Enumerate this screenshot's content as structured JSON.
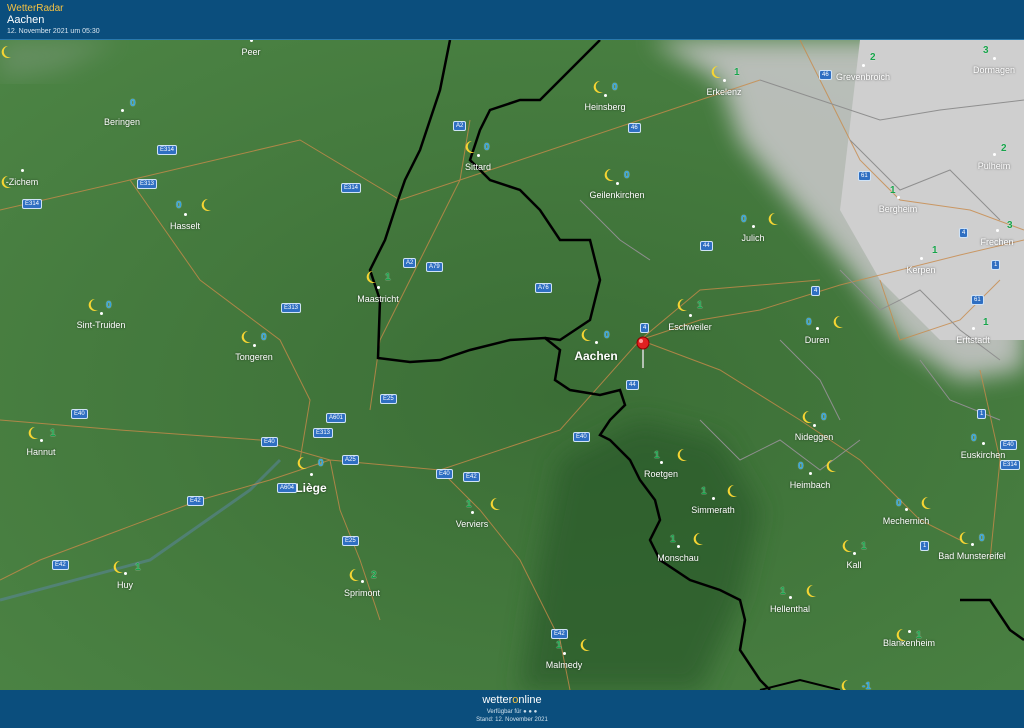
{
  "header": {
    "brand": "WetterRadar",
    "location": "Aachen",
    "timestamp": "12. November 2021 um 05:30"
  },
  "footer": {
    "logo_part1": "wetter",
    "logo_o": "o",
    "logo_part2": "nline",
    "available": "Verfügbar für ● ● ●",
    "stand": "Stand: 12. November 2021"
  },
  "colors": {
    "land": "#3d7437",
    "cloud": "#c9c9c9",
    "header": "#0b4e7d",
    "temp_below": "#2fa3e0",
    "temp_above": "#17a34a",
    "moon": "#f6d533"
  },
  "places": [
    {
      "id": "peer",
      "name": "Peer",
      "temp": ""
    },
    {
      "id": "beringen",
      "name": "Beringen",
      "temp": "0"
    },
    {
      "id": "zichem",
      "name": "-Zichem",
      "temp": ""
    },
    {
      "id": "hasselt",
      "name": "Hasselt",
      "temp": "0"
    },
    {
      "id": "sint-truiden",
      "name": "Sint-Truiden",
      "temp": "0"
    },
    {
      "id": "tongeren",
      "name": "Tongeren",
      "temp": "0"
    },
    {
      "id": "hannut",
      "name": "Hannut",
      "temp": "1"
    },
    {
      "id": "liege",
      "name": "Liège",
      "temp": "0"
    },
    {
      "id": "huy",
      "name": "Huy",
      "temp": "1"
    },
    {
      "id": "sprimont",
      "name": "Sprimont",
      "temp": "2"
    },
    {
      "id": "verviers",
      "name": "Verviers",
      "temp": "1"
    },
    {
      "id": "malmedy",
      "name": "Malmedy",
      "temp": "1"
    },
    {
      "id": "maastricht",
      "name": "Maastricht",
      "temp": "1"
    },
    {
      "id": "sittard",
      "name": "Sittard",
      "temp": "0"
    },
    {
      "id": "heinsberg",
      "name": "Heinsberg",
      "temp": "0"
    },
    {
      "id": "geilenkirchen",
      "name": "Geilenkirchen",
      "temp": "0"
    },
    {
      "id": "aachen",
      "name": "Aachen",
      "temp": "0"
    },
    {
      "id": "eschweiler",
      "name": "Eschweiler",
      "temp": "1"
    },
    {
      "id": "roetgen",
      "name": "Roetgen",
      "temp": "1"
    },
    {
      "id": "simmerath",
      "name": "Simmerath",
      "temp": "1"
    },
    {
      "id": "monschau",
      "name": "Monschau",
      "temp": "1"
    },
    {
      "id": "erkelenz",
      "name": "Erkelenz",
      "temp": "1"
    },
    {
      "id": "julich",
      "name": "Julich",
      "temp": "0"
    },
    {
      "id": "duren",
      "name": "Duren",
      "temp": "0"
    },
    {
      "id": "nideggen",
      "name": "Nideggen",
      "temp": "0"
    },
    {
      "id": "heimbach",
      "name": "Heimbach",
      "temp": "0"
    },
    {
      "id": "hellenthal",
      "name": "Hellenthal",
      "temp": "1"
    },
    {
      "id": "grevenbroich",
      "name": "Grevenbroich",
      "temp": "2"
    },
    {
      "id": "dormagen",
      "name": "Dormagen",
      "temp": "3"
    },
    {
      "id": "pulheim",
      "name": "Pulheim",
      "temp": "2"
    },
    {
      "id": "bergheim",
      "name": "Bergheim",
      "temp": "1"
    },
    {
      "id": "kerpen",
      "name": "Kerpen",
      "temp": "1"
    },
    {
      "id": "frechen",
      "name": "Frechen",
      "temp": "3"
    },
    {
      "id": "erftstadt",
      "name": "Erftstadt",
      "temp": "1"
    },
    {
      "id": "euskirchen",
      "name": "Euskirchen",
      "temp": "0"
    },
    {
      "id": "mechernich",
      "name": "Mechernich",
      "temp": "0"
    },
    {
      "id": "bad-munstereifel",
      "name": "Bad Munstereifel",
      "temp": "0"
    },
    {
      "id": "kall",
      "name": "Kall",
      "temp": "1"
    },
    {
      "id": "blankenheim",
      "name": "Blankenheim",
      "temp": "1"
    },
    {
      "id": "south-edge",
      "name": "",
      "temp": "-1"
    }
  ],
  "roads": [
    "E314",
    "E313",
    "E314",
    "E314",
    "E313",
    "A2",
    "A2",
    "A79",
    "A76",
    "E25",
    "A601",
    "E313",
    "A25",
    "E40",
    "E40",
    "E40",
    "E40",
    "E42",
    "E42",
    "A604",
    "E42",
    "E25",
    "E42",
    "46",
    "46",
    "4",
    "44",
    "44",
    "4",
    "61",
    "4",
    "1",
    "61",
    "1",
    "1",
    "E40",
    "E314"
  ]
}
